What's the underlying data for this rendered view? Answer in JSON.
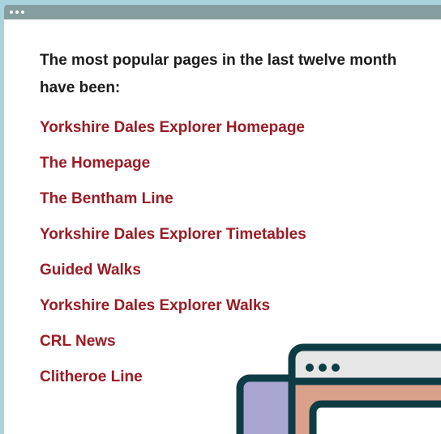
{
  "window": {
    "dots_icon": "three-dots-icon"
  },
  "heading": "The most popular pages in the last twelve month have been:",
  "links": [
    "Yorkshire Dales Explorer Homepage",
    "The Homepage",
    "The Bentham Line",
    "Yorkshire Dales Explorer Timetables",
    "Guided Walks",
    "Yorkshire Dales Explorer Walks",
    "CRL News",
    "Clitheroe Line"
  ],
  "colors": {
    "background": "#a8d3dc",
    "titlebar": "#869ea0",
    "link": "#9b1b24",
    "illustration_dark": "#0e3c44",
    "illustration_purple": "#a9a6d1",
    "illustration_salmon": "#d9a08a"
  },
  "illustration": {
    "name": "browser-windows-illustration"
  }
}
